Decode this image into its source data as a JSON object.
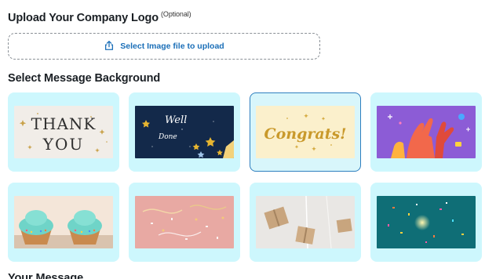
{
  "upload": {
    "title": "Upload Your Company Logo",
    "optional": "(Optional)",
    "button_label": "Select Image file to upload",
    "accent": "#1b6fb8"
  },
  "background": {
    "title": "Select Message Background",
    "selected_index": 2,
    "options": [
      {
        "name": "thank-you",
        "text": [
          "THANK",
          "YOU"
        ]
      },
      {
        "name": "well-done",
        "text": [
          "Well",
          "Done"
        ]
      },
      {
        "name": "congrats",
        "text": [
          "Congrats!"
        ]
      },
      {
        "name": "high-five",
        "text": []
      },
      {
        "name": "cupcakes",
        "text": []
      },
      {
        "name": "pink-confetti",
        "text": []
      },
      {
        "name": "gift-boxes",
        "text": []
      },
      {
        "name": "teal-confetti",
        "text": []
      }
    ]
  },
  "message": {
    "title": "Your Message"
  },
  "colors": {
    "card_bg": "#cdf7fd",
    "selected_border": "#2e7fbf"
  }
}
